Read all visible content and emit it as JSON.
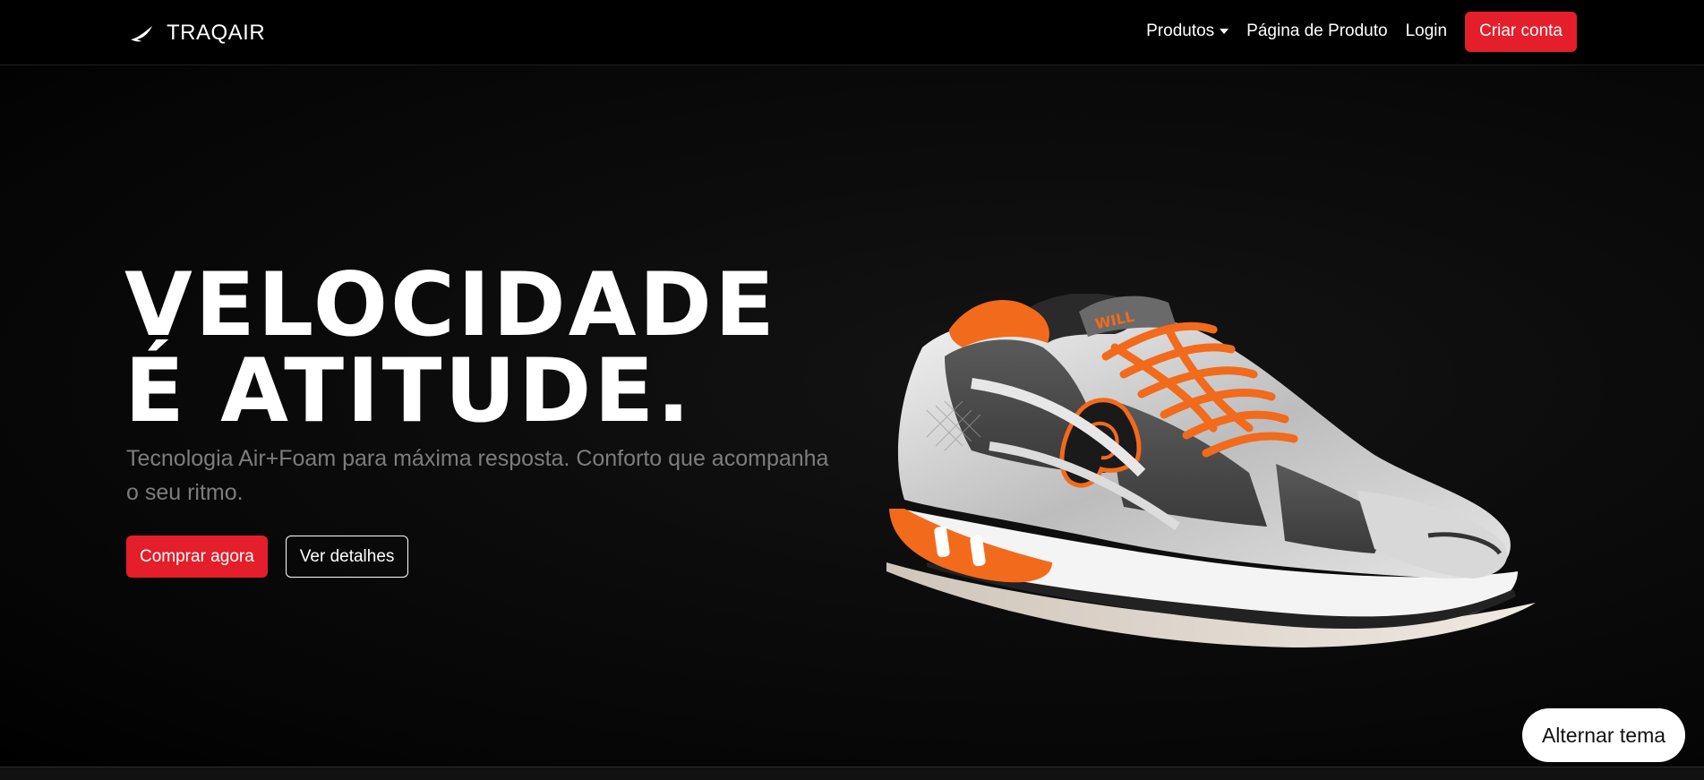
{
  "brand": {
    "name": "TRAQAIR",
    "icon": "wing-icon"
  },
  "nav": {
    "items": [
      {
        "label": "Produtos",
        "has_dropdown": true
      },
      {
        "label": "Página de Produto"
      },
      {
        "label": "Login"
      }
    ],
    "cta_label": "Criar conta"
  },
  "hero": {
    "title_line1": "VELOCIDADE",
    "title_line2": "É ATITUDE.",
    "subtitle": "Tecnologia Air+Foam para máxima resposta. Conforto que acompanha o seu ritmo.",
    "primary_label": "Comprar agora",
    "secondary_label": "Ver detalhes"
  },
  "theme_toggle": {
    "label": "Alternar tema"
  },
  "colors": {
    "accent": "#e41e2b",
    "background": "#000000",
    "subtitle": "#7d7d7d",
    "shoe_accent": "#f26a1b"
  }
}
